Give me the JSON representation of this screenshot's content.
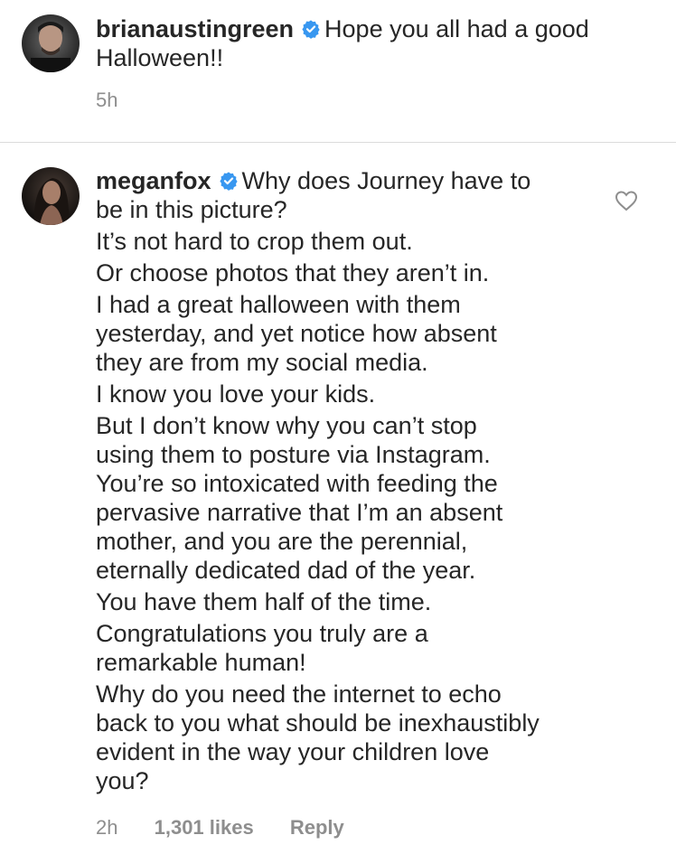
{
  "comments": [
    {
      "username": "brianaustingreen",
      "verified": true,
      "lines": [
        "Hope you all had a good",
        "Halloween!!"
      ],
      "time": "5h"
    },
    {
      "username": "meganfox",
      "verified": true,
      "lines": [
        "Why does Journey have to",
        "be in this picture?",
        "It’s not hard to crop them out.",
        "Or choose photos that they aren’t in.",
        "I had a great halloween with them",
        "yesterday, and yet notice how absent",
        "they are from my social media.",
        "I know you love your kids.",
        "But I don’t know why you can’t stop",
        "using them to posture via Instagram.",
        "You’re so intoxicated with feeding the",
        "pervasive narrative that I’m an absent",
        "mother, and you are the perennial,",
        "eternally dedicated dad of the year.",
        "You have them half of the time.",
        "Congratulations you truly are a",
        "remarkable human!",
        "Why do you need the internet to echo",
        "back to you what should be inexhaustibly",
        "evident in the way your children love",
        "you?"
      ],
      "time": "2h",
      "likes": "1,301 likes",
      "reply_label": "Reply"
    }
  ],
  "icons": {
    "verified": "verified-badge-icon",
    "heart": "heart-outline-icon"
  },
  "colors": {
    "text": "#262626",
    "muted": "#8e8e8e",
    "verified": "#3897f0",
    "divider": "#dbdbdb"
  }
}
